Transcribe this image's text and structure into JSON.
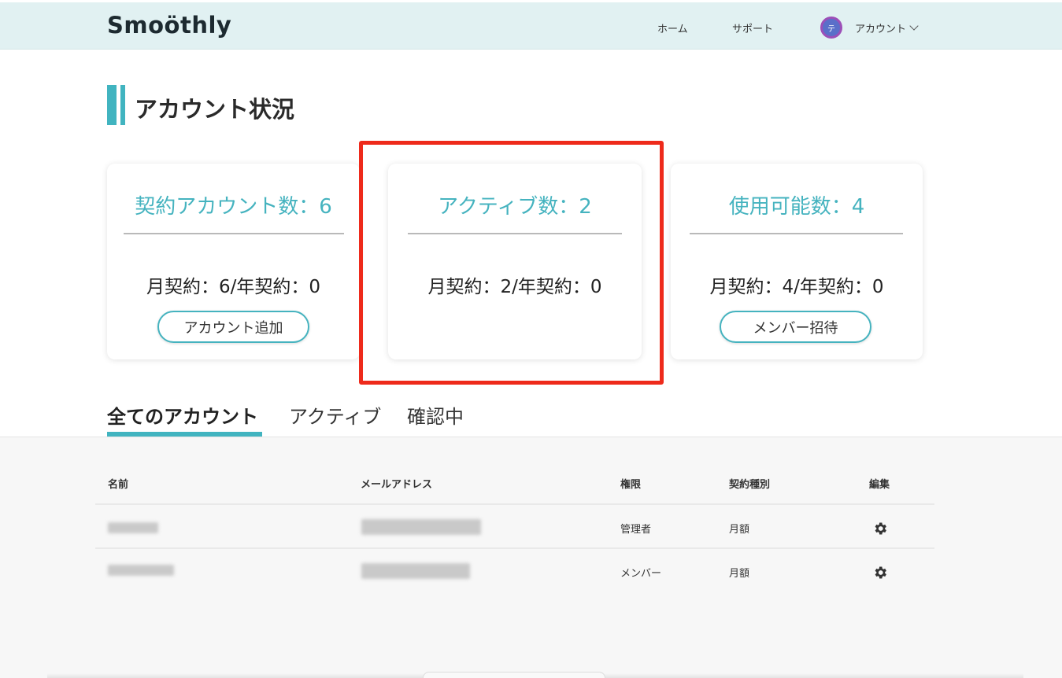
{
  "header": {
    "logo": "Smoöthly",
    "nav_home": "ホーム",
    "nav_support": "サポート",
    "avatar_initial": "テ",
    "nav_account": "アカウント"
  },
  "section_title": "アカウント状況",
  "cards": [
    {
      "title": "契約アカウント数：6",
      "sub": "月契約：6/年契約：0",
      "button": "アカウント追加"
    },
    {
      "title": "アクティブ数：2",
      "sub": "月契約：2/年契約：0"
    },
    {
      "title": "使用可能数：4",
      "sub": "月契約：4/年契約：0",
      "button": "メンバー招待"
    }
  ],
  "tabs": [
    "全てのアカウント",
    "アクティブ",
    "確認中"
  ],
  "table": {
    "headers": [
      "名前",
      "メールアドレス",
      "権限",
      "契約種別",
      "編集"
    ],
    "rows": [
      {
        "role": "管理者",
        "plan": "月額"
      },
      {
        "role": "メンバー",
        "plan": "月額"
      }
    ]
  },
  "colors": {
    "accent": "#41b4c0",
    "highlight": "#ee2a1b",
    "header_bg": "#e1f1f2"
  }
}
